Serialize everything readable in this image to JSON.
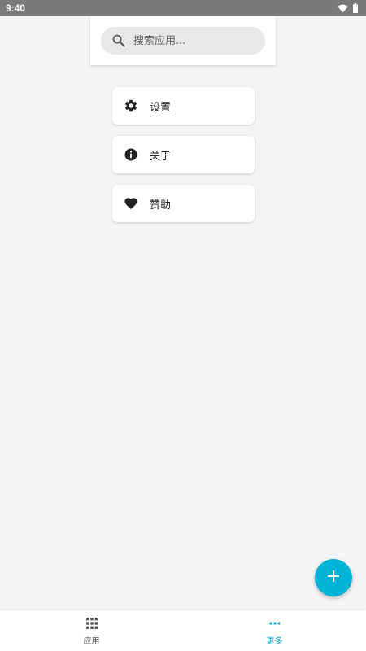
{
  "status_bar": {
    "time": "9:40",
    "icons": [
      "wifi-icon",
      "battery-icon"
    ]
  },
  "search": {
    "placeholder": "搜索应用...",
    "value": ""
  },
  "menu": {
    "items": [
      {
        "label": "设置",
        "icon": "gear-icon"
      },
      {
        "label": "关于",
        "icon": "info-icon"
      },
      {
        "label": "赞助",
        "icon": "heart-icon"
      }
    ]
  },
  "fab": {
    "icon": "plus-icon",
    "color": "#00b4d8"
  },
  "bottom_nav": {
    "items": [
      {
        "label": "应用",
        "icon": "grid-icon",
        "active": false
      },
      {
        "label": "更多",
        "icon": "more-dots-icon",
        "active": true
      }
    ],
    "active_color": "#00a9cf"
  }
}
